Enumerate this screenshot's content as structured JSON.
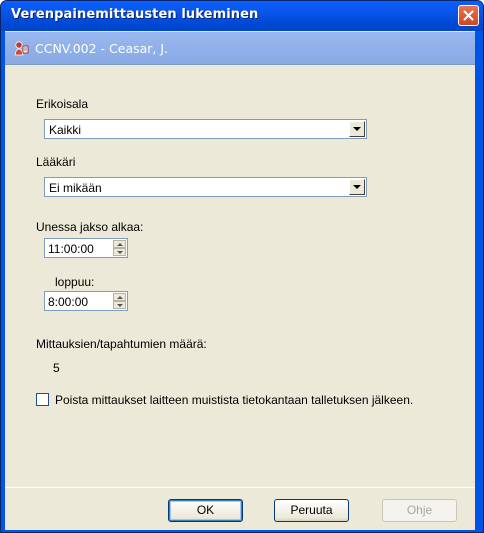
{
  "window": {
    "title": "Verenpainemittausten lukeminen"
  },
  "patient": {
    "label": "CCNV.002 - Ceasar, J.",
    "icon": "patient-icon"
  },
  "specialty": {
    "label": "Erikoisala",
    "value": "Kaikki"
  },
  "doctor": {
    "label": "Lääkäri",
    "value": "Ei mikään"
  },
  "sleep": {
    "start_label": "Unessa jakso alkaa:",
    "start_value": "11:00:00",
    "end_label": "loppuu:",
    "end_value": "8:00:00"
  },
  "measurements": {
    "label": "Mittauksien/tapahtumien määrä:",
    "count": "5"
  },
  "delete_option": {
    "label": "Poista mittaukset laitteen muistista tietokantaan talletuksen jälkeen.",
    "checked": false
  },
  "buttons": {
    "ok": "OK",
    "cancel": "Peruuta",
    "help": "Ohje"
  },
  "colors": {
    "title_bar": "#0055e5",
    "dialog_bg": "#ece9d8",
    "patient_bar": "#93b3ea",
    "close_button": "#d9512d"
  }
}
